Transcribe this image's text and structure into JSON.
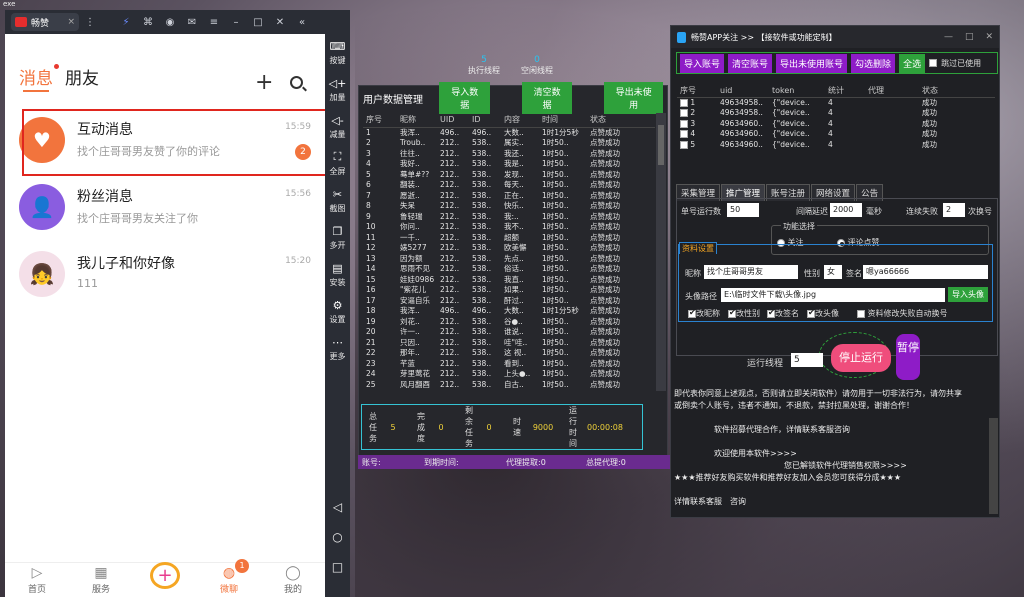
{
  "desktop": {
    "corner_text": "exe"
  },
  "emulator": {
    "tab_title": "畅赞",
    "side_buttons": [
      "按键",
      "加量",
      "减量",
      "全屏",
      "截图",
      "多开",
      "安装",
      "设置",
      "更多"
    ],
    "toolbar_icons": [
      "lightning-icon",
      "gamepad-icon",
      "user-icon",
      "mail-icon",
      "fold-icon",
      "minimize-icon",
      "maximize-icon",
      "close-icon",
      "collapse-icon"
    ]
  },
  "phone": {
    "tabs": {
      "active": "消息",
      "other": "朋友"
    },
    "conversations": [
      {
        "name": "互动消息",
        "sub": "找个庄哥哥男友赞了你的评论",
        "time": "15:59",
        "count": "2",
        "color": "#f2743d",
        "icon": "♥"
      },
      {
        "name": "粉丝消息",
        "sub": "找个庄哥哥男友关注了你",
        "time": "15:56",
        "count": "",
        "color": "#8a5de0",
        "icon": "👤"
      },
      {
        "name": "我儿子和你好像",
        "sub": "111",
        "time": "15:20",
        "count": "",
        "color": "#f4dfe8",
        "icon": "👧"
      }
    ],
    "nav": [
      {
        "label": "首页",
        "icon": "▷"
      },
      {
        "label": "服务",
        "icon": "▦"
      },
      {
        "label": "",
        "icon": "+"
      },
      {
        "label": "微聊",
        "icon": "◍",
        "badge": "1"
      },
      {
        "label": "我的",
        "icon": "◯"
      }
    ]
  },
  "stats": {
    "exec_value": "5",
    "exec_label": "执行线程",
    "idle_value": "0",
    "idle_label": "空闲线程"
  },
  "mid": {
    "title": "用户数据管理",
    "btn_import": "导入数据",
    "btn_clear": "清空数据",
    "btn_export": "导出未使用",
    "headers": [
      "序号",
      "昵称",
      "UID",
      "ID",
      "内容",
      "时间",
      "状态"
    ],
    "rows": [
      [
        "1",
        "我浑..",
        "496..",
        "496..",
        "大数..",
        "1时1分5秒",
        "点赞成功"
      ],
      [
        "2",
        "Troub..",
        "212..",
        "538..",
        "属实..",
        "1时50..",
        "点赞成功"
      ],
      [
        "3",
        "往往..",
        "212..",
        "538..",
        "我还..",
        "1时50..",
        "点赞成功"
      ],
      [
        "4",
        "我好..",
        "212..",
        "538..",
        "我是..",
        "1时50..",
        "点赞成功"
      ],
      [
        "5",
        "蓦单#??",
        "212..",
        "538..",
        "发现..",
        "1时50..",
        "点赞成功"
      ],
      [
        "6",
        "翻装..",
        "212..",
        "538..",
        "每天..",
        "1时50..",
        "点赞成功"
      ],
      [
        "7",
        "愿逝..",
        "212..",
        "538..",
        "正在..",
        "1时50..",
        "点赞成功"
      ],
      [
        "8",
        "失呆",
        "212..",
        "538..",
        "快乐..",
        "1时50..",
        "点赞成功"
      ],
      [
        "9",
        "鲁轻瑞",
        "212..",
        "538..",
        "我:..",
        "1时50..",
        "点赞成功"
      ],
      [
        "10",
        "你问..",
        "212..",
        "538..",
        "我不..",
        "1时50..",
        "点赞成功"
      ],
      [
        "11",
        "一千..",
        "212..",
        "538..",
        "超额",
        "1时50..",
        "点赞成功"
      ],
      [
        "12",
        "婊5277",
        "212..",
        "538..",
        "欧美懈",
        "1时50..",
        "点赞成功"
      ],
      [
        "13",
        "因为额",
        "212..",
        "538..",
        "先点..",
        "1时50..",
        "点赞成功"
      ],
      [
        "14",
        "思雨不见",
        "212..",
        "538..",
        "俗话..",
        "1时50..",
        "点赞成功"
      ],
      [
        "15",
        "娃娃0986",
        "212..",
        "538..",
        "我直..",
        "1时50..",
        "点赞成功"
      ],
      [
        "16",
        "\"紫花儿",
        "212..",
        "538..",
        "如果..",
        "1时50..",
        "点赞成功"
      ],
      [
        "17",
        "安逼自乐",
        "212..",
        "538..",
        "酐过..",
        "1时50..",
        "点赞成功"
      ],
      [
        "18",
        "我浑..",
        "496..",
        "496..",
        "大数..",
        "1时1分5秒",
        "点赞成功"
      ],
      [
        "19",
        "刘花..",
        "212..",
        "538..",
        "谷●..",
        "1时50..",
        "点赞成功"
      ],
      [
        "20",
        "许一..",
        "212..",
        "538..",
        "谁说..",
        "1时50..",
        "点赞成功"
      ],
      [
        "21",
        "只因..",
        "212..",
        "538..",
        "哇\"哇..",
        "1时50..",
        "点赞成功"
      ],
      [
        "22",
        "那年..",
        "212..",
        "538..",
        "这 视..",
        "1时50..",
        "点赞成功"
      ],
      [
        "23",
        "芊蓝",
        "212..",
        "538..",
        "看到..",
        "1时50..",
        "点赞成功"
      ],
      [
        "24",
        "芽里莺花",
        "212..",
        "538..",
        "上头●..",
        "1时50..",
        "点赞成功"
      ],
      [
        "25",
        "风月翻酉",
        "212..",
        "538..",
        "自古..",
        "1时50..",
        "点赞成功"
      ]
    ],
    "summary": {
      "total_label": "总任务",
      "total": "5",
      "done_label": "完成度",
      "done": "0",
      "remain_label": "剩余任务",
      "remain": "0",
      "speed_label": "时速",
      "speed": "9000",
      "runtime_label": "运行时间",
      "runtime": "00:00:08"
    },
    "footer": {
      "account": "账号:",
      "expire": "到期时间:",
      "agent_fee": "代理提取:0",
      "total_agent": "总提代理:0"
    }
  },
  "right": {
    "title": "畅赞APP关注 >> 【接软件或功能定制】",
    "buttons": [
      "导入账号",
      "清空账号",
      "导出未使用账号",
      "勾选删除",
      "全选"
    ],
    "skip_used": "跳过已使用",
    "headers": [
      "序号",
      "uid",
      "token",
      "统计",
      "代理",
      "状态"
    ],
    "rows": [
      [
        "1",
        "49634958..",
        "{\"device..",
        "4",
        "",
        "成功"
      ],
      [
        "2",
        "49634958..",
        "{\"device..",
        "4",
        "",
        "成功"
      ],
      [
        "3",
        "49634960..",
        "{\"device..",
        "4",
        "",
        "成功"
      ],
      [
        "4",
        "49634960..",
        "{\"device..",
        "4",
        "",
        "成功"
      ],
      [
        "5",
        "49634960..",
        "{\"device..",
        "4",
        "",
        "成功"
      ]
    ],
    "tabs": [
      "采集管理",
      "推广管理",
      "账号注册",
      "网络设置",
      "公告"
    ],
    "form": {
      "single_label": "单号运行数",
      "single_val": "50",
      "interval_label": "间隔延迟",
      "interval_val": "2000",
      "interval_unit": "毫秒",
      "fail_label": "连续失败",
      "fail_val": "2",
      "fail_unit": "次换号",
      "func_label": "功能选择",
      "opt_follow": "关注",
      "opt_like": "评论点赞",
      "info_tab": "资料设置",
      "nick_label": "昵称",
      "nick_val": "找个庄哥哥男友",
      "gender_label": "性别",
      "gender_val": "女",
      "sign_label": "签名",
      "sign_val": "嗯ya66666",
      "avatar_label": "头像路径",
      "avatar_val": "E:\\临时文件下载\\头像.jpg",
      "import_avatar": "导入头像",
      "cb_nick": "改昵称",
      "cb_gender": "改性别",
      "cb_sign": "改签名",
      "cb_avatar": "改头像",
      "cb_auto": "资料修改失败自动换号"
    },
    "thread_label": "运行线程",
    "thread_val": "5",
    "stop": "停止运行",
    "pause": "暂停",
    "notice": [
      "即代表你同意上述观点，否则请立即关闭软件）请勿用于一切非法行为，请勿共享",
      "或倒卖个人账号，违者不通知，不退款，禁封拉黑处理，谢谢合作！",
      "",
      "软件招募代理合作，详情联系客服咨询",
      "",
      "欢迎使用本软件>>>>",
      "您已解锁软件代理销售权限>>>>",
      "★★★推荐好友购买软件和推荐好友加入会员您可获得分成★★★",
      "",
      "详情联系客服　咨询"
    ]
  }
}
